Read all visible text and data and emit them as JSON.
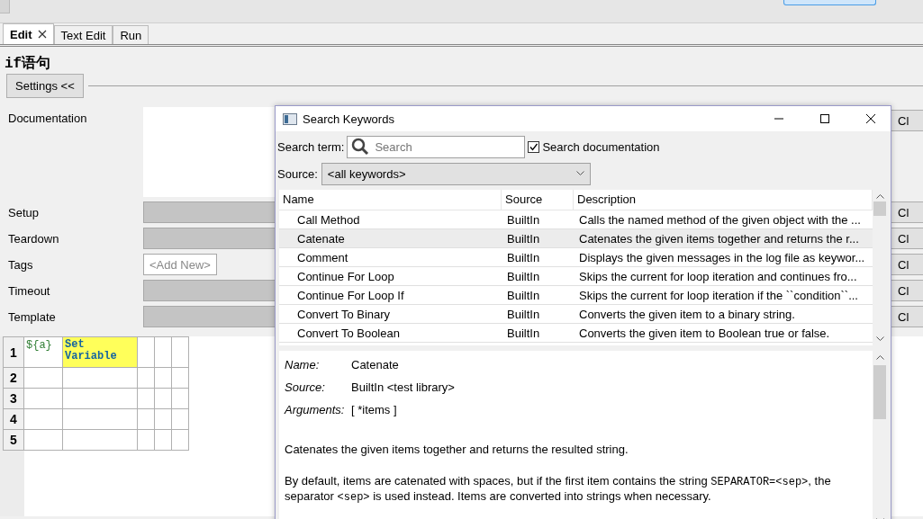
{
  "tabs": [
    {
      "label": "Edit",
      "selected": true,
      "closable": true
    },
    {
      "label": "Text Edit",
      "selected": false,
      "closable": false
    },
    {
      "label": "Run",
      "selected": false,
      "closable": false
    }
  ],
  "heading": "if语句",
  "settings_button": "Settings <<",
  "settings": [
    {
      "label": "Documentation",
      "kind": "textarea",
      "button": "Cl"
    },
    {
      "label": "Setup",
      "kind": "field",
      "button": "Cl"
    },
    {
      "label": "Teardown",
      "kind": "field",
      "button": "Cl"
    },
    {
      "label": "Tags",
      "kind": "tags",
      "add_label": "<Add New>",
      "button": "Cl"
    },
    {
      "label": "Timeout",
      "kind": "field",
      "button": "Cl"
    },
    {
      "label": "Template",
      "kind": "field",
      "button": "Cl"
    }
  ],
  "grid": {
    "rows": [
      {
        "number": "1",
        "cells": [
          {
            "text": "${a}",
            "kind": "variable"
          },
          {
            "text": "Set Variable",
            "kind": "keyword"
          },
          {
            "kind": "empty"
          },
          {
            "kind": "empty"
          },
          {
            "kind": "empty"
          }
        ]
      },
      {
        "number": "2",
        "cells": [
          {
            "kind": "empty"
          },
          {
            "kind": "empty"
          },
          {
            "kind": "empty"
          },
          {
            "kind": "empty"
          },
          {
            "kind": "empty"
          }
        ]
      },
      {
        "number": "3",
        "cells": [
          {
            "kind": "empty"
          },
          {
            "kind": "empty"
          },
          {
            "kind": "empty"
          },
          {
            "kind": "empty"
          },
          {
            "kind": "empty"
          }
        ]
      },
      {
        "number": "4",
        "cells": [
          {
            "kind": "empty"
          },
          {
            "kind": "empty"
          },
          {
            "kind": "empty"
          },
          {
            "kind": "empty"
          },
          {
            "kind": "empty"
          }
        ]
      },
      {
        "number": "5",
        "cells": [
          {
            "kind": "empty"
          },
          {
            "kind": "empty"
          },
          {
            "kind": "empty"
          },
          {
            "kind": "empty"
          },
          {
            "kind": "empty"
          }
        ]
      }
    ]
  },
  "dialog": {
    "title": "Search Keywords",
    "search_label": "Search term:",
    "search": {
      "placeholder": "Search"
    },
    "search_documentation": {
      "label": "Search documentation",
      "checked": true
    },
    "source_label": "Source:",
    "source_value": "<all keywords>",
    "columns": [
      "Name",
      "Source",
      "Description"
    ],
    "rows": [
      {
        "name": "Call Method",
        "source": "BuiltIn",
        "description": "Calls the named method of the given object with the ...",
        "selected": false
      },
      {
        "name": "Catenate",
        "source": "BuiltIn",
        "description": "Catenates the given items together and returns the r...",
        "selected": true
      },
      {
        "name": "Comment",
        "source": "BuiltIn",
        "description": "Displays the given messages in the log file as keywor...",
        "selected": false
      },
      {
        "name": "Continue For Loop",
        "source": "BuiltIn",
        "description": "Skips the current for loop iteration and continues fro...",
        "selected": false
      },
      {
        "name": "Continue For Loop If",
        "source": "BuiltIn",
        "description": "Skips the current for loop iteration if the ``condition``...",
        "selected": false
      },
      {
        "name": "Convert To Binary",
        "source": "BuiltIn",
        "description": "Converts the given item to a binary string.",
        "selected": false
      },
      {
        "name": "Convert To Boolean",
        "source": "BuiltIn",
        "description": "Converts the given item to Boolean true or false.",
        "selected": false
      }
    ],
    "details": {
      "fields": [
        {
          "label": "Name:",
          "value": "Catenate"
        },
        {
          "label": "Source:",
          "value": "BuiltIn <test library>"
        },
        {
          "label": "Arguments:",
          "value": "[ *items ]"
        }
      ],
      "paragraphs": [
        [
          {
            "kind": "text",
            "text": "Catenates the given items together and returns the resulted string."
          }
        ],
        [
          {
            "kind": "text",
            "text": "By default, items are catenated with spaces, but if the first item contains the string "
          },
          {
            "kind": "code",
            "text": "SEPARATOR=<sep>"
          },
          {
            "kind": "text",
            "text": ", the separator "
          },
          {
            "kind": "code",
            "text": "<sep>"
          },
          {
            "kind": "text",
            "text": " is used instead. Items are converted into strings when necessary."
          }
        ]
      ]
    }
  }
}
